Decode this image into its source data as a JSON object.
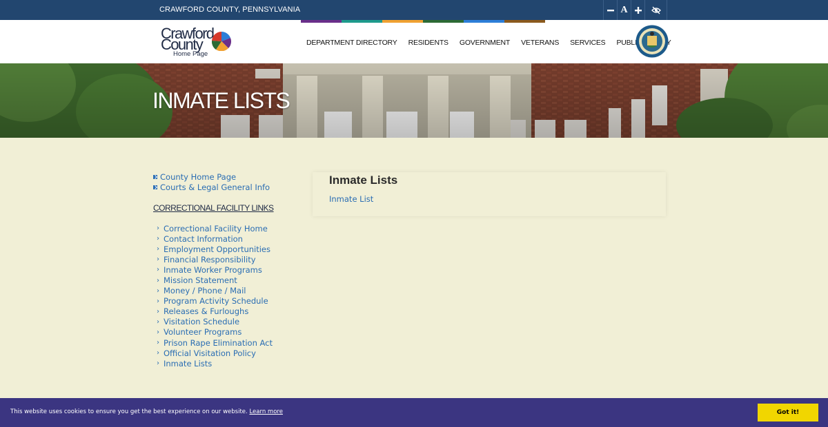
{
  "topbar": {
    "county": "CRAWFORD COUNTY, PENNSYLVANIA",
    "tools": [
      {
        "icon": "minus-icon"
      },
      {
        "icon": "font-size-icon",
        "label": "A"
      },
      {
        "icon": "plus-icon"
      },
      {
        "icon": "hide-eye-icon"
      }
    ]
  },
  "header": {
    "logo": {
      "line1": "Crawford",
      "line2": "County",
      "sub": "Home Page"
    },
    "colorbar": [
      "#6a2f8a",
      "#1e9a8c",
      "#f0a132",
      "#2c6a35",
      "#2d7ed8",
      "#8b5a1e"
    ],
    "nav": [
      "DEPARTMENT DIRECTORY",
      "RESIDENTS",
      "GOVERNMENT",
      "VETERANS",
      "SERVICES",
      "PUBLIC SAFETY"
    ]
  },
  "hero": {
    "title": "INMATE LISTS"
  },
  "sidebar": {
    "top_links": [
      "County Home Page",
      "Courts & Legal General Info"
    ],
    "heading": "CORRECTIONAL FACILITY LINKS",
    "links": [
      "Correctional Facility Home",
      "Contact Information",
      "Employment Opportunities",
      "Financial Responsibility",
      "Inmate Worker Programs",
      "Mission Statement",
      "Money / Phone / Mail",
      "Program Activity Schedule",
      "Releases & Furloughs",
      "Visitation Schedule",
      "Volunteer Programs",
      "Prison Rape Elimination Act",
      "Official Visitation Policy",
      "Inmate Lists"
    ]
  },
  "content": {
    "title": "Inmate Lists",
    "link": "Inmate List"
  },
  "cookie": {
    "message": "This website uses cookies to ensure you get the best experience on our website.",
    "learn_more": "Learn more",
    "button": "Got it!"
  },
  "colors": {
    "topbar": "#22466f",
    "link": "#2a6db3",
    "background": "#f1efd6",
    "cookie_bar": "#3b3581",
    "cookie_button": "#f1d600"
  }
}
